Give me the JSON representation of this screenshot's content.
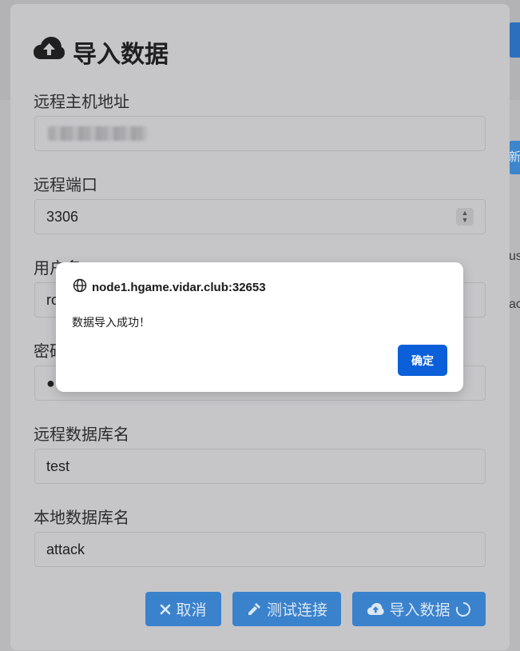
{
  "background": {
    "right_button_fragment": "新",
    "right_text_fragment_1": "us",
    "right_text_fragment_2": "ac"
  },
  "modal": {
    "title": "导入数据",
    "title_icon": "cloud-upload-icon",
    "fields": {
      "host": {
        "label": "远程主机地址",
        "value": ""
      },
      "port": {
        "label": "远程端口",
        "value": "3306"
      },
      "username": {
        "label": "用户名",
        "value": "ro"
      },
      "password": {
        "label": "密码",
        "value": "●"
      },
      "remote_db": {
        "label": "远程数据库名",
        "value": "test"
      },
      "local_db": {
        "label": "本地数据库名",
        "value": "attack"
      }
    },
    "buttons": {
      "cancel": "取消",
      "test": "测试连接",
      "import": "导入数据"
    }
  },
  "alert": {
    "origin": "node1.hgame.vidar.club:32653",
    "message": "数据导入成功！",
    "ok": "确定"
  },
  "colors": {
    "primary_button": "#3a82cc",
    "alert_button": "#0b5fd8",
    "overlay": "#b9b9bc"
  }
}
